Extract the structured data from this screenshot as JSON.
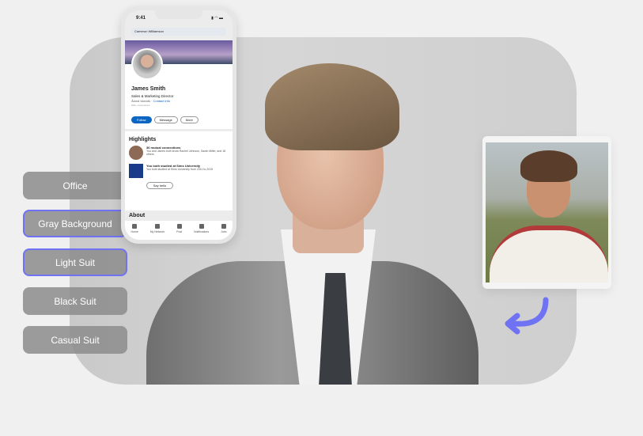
{
  "options": [
    {
      "label": "Office",
      "selected": false
    },
    {
      "label": "Gray Background",
      "selected": true
    },
    {
      "label": "Light Suit",
      "selected": true
    },
    {
      "label": "Black Suit",
      "selected": false
    },
    {
      "label": "Casual Suit",
      "selected": false
    }
  ],
  "accent_color": "#6f72f2",
  "phone": {
    "time": "9:41",
    "search_value": "Cameron Williamson",
    "profile": {
      "name": "James Smith",
      "title": "Sales & Marketing Director",
      "location": "Åland Islands",
      "contact_link": "Contact info",
      "connections": "500+ connections"
    },
    "buttons": {
      "follow": "Follow",
      "message": "Message",
      "more": "More"
    },
    "highlights": {
      "title": "Highlights",
      "mutual_title": "36 mutual connections",
      "mutual_text": "You and James both know Rachel Johnson, Sarah Miller, and 18 others",
      "school_title": "You both studied at Sims University",
      "school_text": "You both studied at Sims University from 2011 to 2015",
      "say_hello": "Say hello"
    },
    "about_title": "About",
    "nav": [
      "Home",
      "My Network",
      "Post",
      "Notifications",
      "Jobs"
    ]
  }
}
